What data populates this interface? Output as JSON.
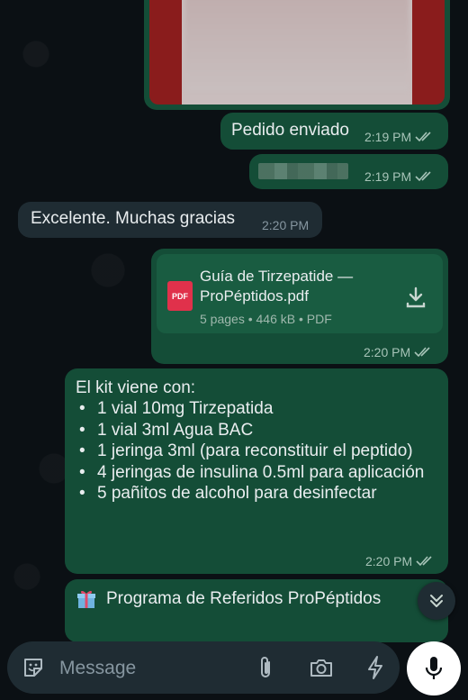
{
  "messages": {
    "image": {
      "time": "",
      "blurred": true
    },
    "pedido": {
      "text": "Pedido enviado",
      "time": "2:19 PM"
    },
    "redacted": {
      "time": "2:19 PM"
    },
    "gracias": {
      "text": "Excelente. Muchas gracias",
      "time": "2:20 PM"
    },
    "document": {
      "name": "Guía de Tirzepatide — ProPéptidos.pdf",
      "icon_label": "PDF",
      "info": "5 pages • 446 kB • PDF",
      "time": "2:20 PM"
    },
    "kit": {
      "title": "El kit viene con:",
      "items": [
        "1 vial 10mg Tirzepatida",
        "1 vial 3ml Agua BAC",
        "1 jeringa 3ml (para reconstituir el peptido)",
        "4 jeringas de insulina 0.5ml para aplicación",
        "5 pañitos de alcohol para desinfectar"
      ],
      "time": "2:20 PM"
    },
    "referidos": {
      "text": "Programa de Referidos ProPéptidos"
    }
  },
  "input": {
    "placeholder": "Message"
  },
  "icons": [
    "sticker-icon",
    "attach-icon",
    "camera-icon",
    "bolt-icon",
    "mic-icon",
    "scroll-down-icon",
    "download-icon",
    "gift-icon",
    "double-check-icon"
  ],
  "colors": {
    "outgoing": "#144d37",
    "incoming": "#1f2c33",
    "background": "#0b1014",
    "pdf": "#e0314b"
  }
}
